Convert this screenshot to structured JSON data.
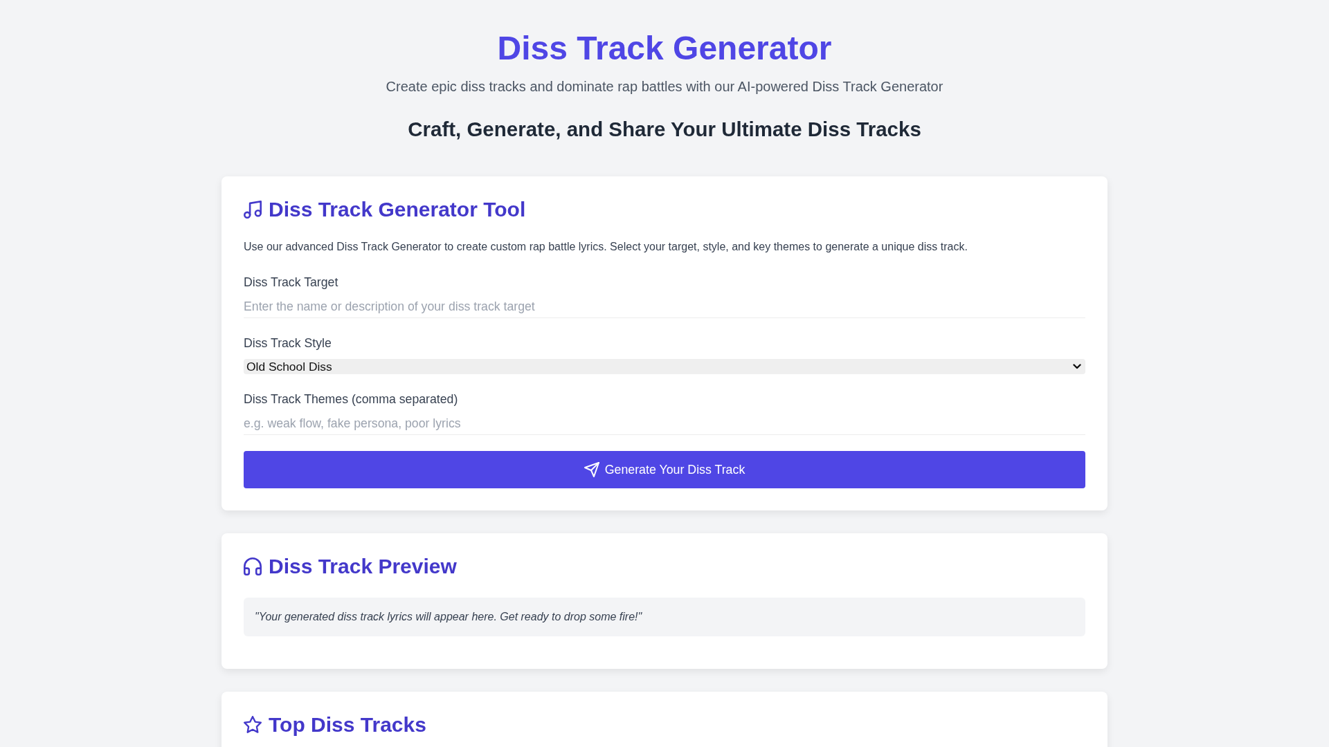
{
  "header": {
    "title": "Diss Track Generator",
    "subtitle": "Create epic diss tracks and dominate rap battles with our AI-powered Diss Track Generator",
    "tagline": "Craft, Generate, and Share Your Ultimate Diss Tracks"
  },
  "generator_tool": {
    "title": "Diss Track Generator Tool",
    "description": "Use our advanced Diss Track Generator to create custom rap battle lyrics. Select your target, style, and key themes to generate a unique diss track.",
    "fields": [
      {
        "kind": "text",
        "label": "Diss Track Target",
        "placeholder": "Enter the name or description of your diss track target"
      },
      {
        "kind": "select",
        "label": "Diss Track Style",
        "value": "Old School Diss"
      },
      {
        "kind": "text",
        "label": "Diss Track Themes (comma separated)",
        "placeholder": "e.g. weak flow, fake persona, poor lyrics"
      }
    ],
    "button": "Generate Your Diss Track"
  },
  "preview": {
    "title": "Diss Track Preview",
    "text": "\"Your generated diss track lyrics will appear here. Get ready to drop some fire!\""
  },
  "top_tracks": {
    "title": "Top Diss Tracks"
  }
}
